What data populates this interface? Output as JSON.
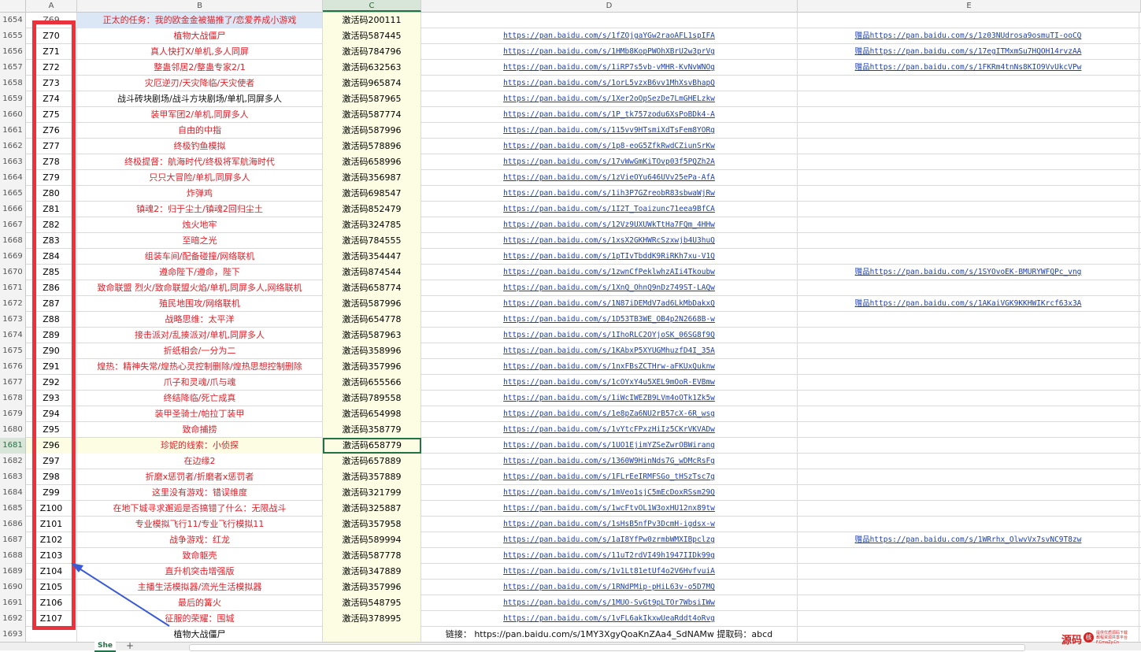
{
  "sheet": {
    "columns": [
      "A",
      "B",
      "C",
      "D",
      "E"
    ],
    "selected_column": "C",
    "selected_row": "1681",
    "rows": [
      {
        "n": "1654",
        "a": "Z69",
        "b": "正太的任务：我的欧金金被猫推了/恋爱养成小游戏",
        "c": "激活码200111",
        "d": "",
        "e": ""
      },
      {
        "n": "1655",
        "a": "Z70",
        "b": "植物大战僵尸",
        "c": "激活码587445",
        "d": "https://pan.baidu.com/s/1fZOjgaYGw2raoAFL1spIFA",
        "e": "赠品https://pan.baidu.com/s/1z03NUdrosa9osmuTI-ooCQ"
      },
      {
        "n": "1656",
        "a": "Z71",
        "b": "真人快打X/单机,多人同屏",
        "c": "激活码784796",
        "d": "https://pan.baidu.com/s/1HMb8KopPWOhXBrU2w3prVg",
        "e": "赠品https://pan.baidu.com/s/17egITMxmSu7HQOH14rvzAA"
      },
      {
        "n": "1657",
        "a": "Z72",
        "b": "整蛊邻居2/整蛊专家2/1",
        "c": "激活码632563",
        "d": "https://pan.baidu.com/s/1iRP7s5vb-vMHR-KvNvWNOg",
        "e": "赠品https://pan.baidu.com/s/1FKRm4tnNs8KIO9VvUkcVPw"
      },
      {
        "n": "1658",
        "a": "Z73",
        "b": "灾厄逆刃/天灾降临/天灾使者",
        "c": "激活码965874",
        "d": "https://pan.baidu.com/s/1orL5vzxB6vv1MhXsvBhapQ",
        "e": ""
      },
      {
        "n": "1659",
        "a": "Z74",
        "b": "战斗砖块剧场/战斗方块剧场/单机,同屏多人",
        "c": "激活码587965",
        "d": "https://pan.baidu.com/s/1Xer2oOpSezDe7LmGHELzkw",
        "e": ""
      },
      {
        "n": "1660",
        "a": "Z75",
        "b": "装甲军团2/单机,同屏多人",
        "c": "激活码587774",
        "d": "https://pan.baidu.com/s/1P_tk757zodu6XsPoBDk4-A",
        "e": ""
      },
      {
        "n": "1661",
        "a": "Z76",
        "b": "自由的中指",
        "c": "激活码587996",
        "d": "https://pan.baidu.com/s/115vv9HTsmiXdTsFem8YORg",
        "e": ""
      },
      {
        "n": "1662",
        "a": "Z77",
        "b": "终极钓鱼模拟",
        "c": "激活码578896",
        "d": "https://pan.baidu.com/s/1p8-eoG5ZfkRwdCZiunSrKw",
        "e": ""
      },
      {
        "n": "1663",
        "a": "Z78",
        "b": "终极提督：航海时代/终极将军航海时代",
        "c": "激活码658996",
        "d": "https://pan.baidu.com/s/17vWwGmKiTOvp03f5PQZh2A",
        "e": ""
      },
      {
        "n": "1664",
        "a": "Z79",
        "b": "只只大冒险/单机,同屏多人",
        "c": "激活码356987",
        "d": "https://pan.baidu.com/s/1zVieOYu646UVv25ePa-AfA",
        "e": ""
      },
      {
        "n": "1665",
        "a": "Z80",
        "b": "炸弹鸡",
        "c": "激活码698547",
        "d": "https://pan.baidu.com/s/1ih3P7GZreobR83sbwaWjRw",
        "e": ""
      },
      {
        "n": "1666",
        "a": "Z81",
        "b": "镇魂2：归于尘土/镇魂2回归尘土",
        "c": "激活码852479",
        "d": "https://pan.baidu.com/s/1I2T_Toaizunc71eea9BfCA",
        "e": ""
      },
      {
        "n": "1667",
        "a": "Z82",
        "b": "烛火地牢",
        "c": "激活码324785",
        "d": "https://pan.baidu.com/s/12Vz9UXUWkTtHa7FQm_4HHw",
        "e": ""
      },
      {
        "n": "1668",
        "a": "Z83",
        "b": "至暗之光",
        "c": "激活码784555",
        "d": "https://pan.baidu.com/s/1xsX2GKHWRcSzxwjb4U3huQ",
        "e": ""
      },
      {
        "n": "1669",
        "a": "Z84",
        "b": "组装车间/配备碰撞/网络联机",
        "c": "激活码354447",
        "d": "https://pan.baidu.com/s/1pTIvTbddK9RiRKh7xu-V1Q",
        "e": ""
      },
      {
        "n": "1670",
        "a": "Z85",
        "b": "遵命陛下/遵命，陛下",
        "c": "激活码874544",
        "d": "https://pan.baidu.com/s/1zwnCfPeklwhzAIi4Tkoubw",
        "e": "赠品https://pan.baidu.com/s/1SYOvoEK-BMURYWFQPc_vng"
      },
      {
        "n": "1671",
        "a": "Z86",
        "b": "致命联盟 烈火/致命联盟火焰/单机,同屏多人,网络联机",
        "c": "激活码658774",
        "d": "https://pan.baidu.com/s/1XnQ_OhnQ9nDz749ST-LAQw",
        "e": ""
      },
      {
        "n": "1672",
        "a": "Z87",
        "b": "殖民地围攻/网络联机",
        "c": "激活码587996",
        "d": "https://pan.baidu.com/s/1N87iDEMdV7ad6LkMbDakxQ",
        "e": "赠品https://pan.baidu.com/s/1AKaiVGK9KKHWIKrcf63x3A"
      },
      {
        "n": "1673",
        "a": "Z88",
        "b": "战略思维：太平洋",
        "c": "激活码654778",
        "d": "https://pan.baidu.com/s/1D53TB3WE_OB4p2N2668B-w",
        "e": ""
      },
      {
        "n": "1674",
        "a": "Z89",
        "b": "接击派对/乱揍派对/单机,同屏多人",
        "c": "激活码587963",
        "d": "https://pan.baidu.com/s/1IhoRLC2OYjoSK_06SG8f9Q",
        "e": ""
      },
      {
        "n": "1675",
        "a": "Z90",
        "b": "折纸相会/一分为二",
        "c": "激活码358996",
        "d": "https://pan.baidu.com/s/1KAbxP5XYUGMhuzfD4I_35A",
        "e": ""
      },
      {
        "n": "1676",
        "a": "Z91",
        "b": "煌热：精神失常/煌热心灵控制删除/煌热思想控制删除",
        "c": "激活码357996",
        "d": "https://pan.baidu.com/s/1nxFBsZCTHrw-aFKUxQuknw",
        "e": ""
      },
      {
        "n": "1677",
        "a": "Z92",
        "b": "爪子和灵魂/爪与魂",
        "c": "激活码655566",
        "d": "https://pan.baidu.com/s/1cOYxY4u5XEL9mOoR-EVBmw",
        "e": ""
      },
      {
        "n": "1678",
        "a": "Z93",
        "b": "终结降临/死亡成真",
        "c": "激活码789558",
        "d": "https://pan.baidu.com/s/1iWcIWEZB9LVm4oOTk1Zk5w",
        "e": ""
      },
      {
        "n": "1679",
        "a": "Z94",
        "b": "装甲圣骑士/帕拉丁装甲",
        "c": "激活码654998",
        "d": "https://pan.baidu.com/s/1e8pZa6NU2rB57cX-6R_wsg",
        "e": ""
      },
      {
        "n": "1680",
        "a": "Z95",
        "b": "致命捕捞",
        "c": "激活码358779",
        "d": "https://pan.baidu.com/s/1vYtcFPxzHiIz5CKrVKVADw",
        "e": ""
      },
      {
        "n": "1681",
        "a": "Z96",
        "b": "珍妮的线索：小侦探",
        "c": "激活码658779",
        "d": "https://pan.baidu.com/s/1UO1EjimYZSeZwrOBWirang",
        "e": ""
      },
      {
        "n": "1682",
        "a": "Z97",
        "b": "在边缘2",
        "c": "激活码657889",
        "d": "https://pan.baidu.com/s/1360W9HinNds7G_wDMcRsFg",
        "e": ""
      },
      {
        "n": "1683",
        "a": "Z98",
        "b": "折磨x惩罚者/折磨者x惩罚者",
        "c": "激活码357889",
        "d": "https://pan.baidu.com/s/1FLrEeIRMFSGo_tHSzTsc7g",
        "e": ""
      },
      {
        "n": "1684",
        "a": "Z99",
        "b": "这里没有游戏：错误维度",
        "c": "激活码321799",
        "d": "https://pan.baidu.com/s/1mVeo1sjC5mEcDoxRSsm29Q",
        "e": ""
      },
      {
        "n": "1685",
        "a": "Z100",
        "b": "在地下城寻求邂逅是否搞错了什么：无限战斗",
        "c": "激活码325887",
        "d": "https://pan.baidu.com/s/1wcFtvOL1W3oxHU12nx89tw",
        "e": ""
      },
      {
        "n": "1686",
        "a": "Z101",
        "b": "专业模拟飞行11/专业飞行模拟11",
        "c": "激活码357958",
        "d": "https://pan.baidu.com/s/1sHsB5nfPv3DcmH-igdsx-w",
        "e": ""
      },
      {
        "n": "1687",
        "a": "Z102",
        "b": "战争游戏：红龙",
        "c": "激活码589994",
        "d": "https://pan.baidu.com/s/1aI8YfPw0zrmbWMXIBpclzg",
        "e": "赠品https://pan.baidu.com/s/1WRrhx_OlwvVx7svNC9T8zw"
      },
      {
        "n": "1688",
        "a": "Z103",
        "b": "致命躯壳",
        "c": "激活码587778",
        "d": "https://pan.baidu.com/s/11uT2rdVI49h1947IIDk99g",
        "e": ""
      },
      {
        "n": "1689",
        "a": "Z104",
        "b": "直升机突击增强版",
        "c": "激活码347889",
        "d": "https://pan.baidu.com/s/1v1Lt81etUf4o2V6HvfvuiA",
        "e": ""
      },
      {
        "n": "1690",
        "a": "Z105",
        "b": "主播生活模拟器/流光生活模拟器",
        "c": "激活码357996",
        "d": "https://pan.baidu.com/s/1RNdPMip-pHiL63v-o5D7MQ",
        "e": ""
      },
      {
        "n": "1691",
        "a": "Z106",
        "b": "最后的篝火",
        "c": "激活码548795",
        "d": "https://pan.baidu.com/s/1MUO-SvGt9pLTOr7WbsiIWw",
        "e": ""
      },
      {
        "n": "1692",
        "a": "Z107",
        "b": "征服的荣耀：围城",
        "c": "激活码378995",
        "d": "https://pan.baidu.com/s/1vFL6akIkxwUeaRddt4oRvg",
        "e": ""
      },
      {
        "n": "1693",
        "a": "",
        "b": "植物大战僵尸",
        "c": "",
        "d": "链接： https://pan.baidu.com/s/1MY3XgyQoaKnZAa4_SdNAMw  提取码：abcd",
        "e": ""
      }
    ]
  },
  "tabs": {
    "sheet_tab": "She",
    "add": "+"
  },
  "watermark": {
    "brand": "源码",
    "ring": "核",
    "line1": "提供优质源码下载",
    "line2": "教程资源共享平台",
    "line3": "F.CmaZy.Cn"
  },
  "colors": {
    "highlight_box": "#e8323c",
    "arrow": "#3a5bd6",
    "link": "#1a3fb5",
    "red_text": "#e0202a",
    "accent": "#217346"
  }
}
